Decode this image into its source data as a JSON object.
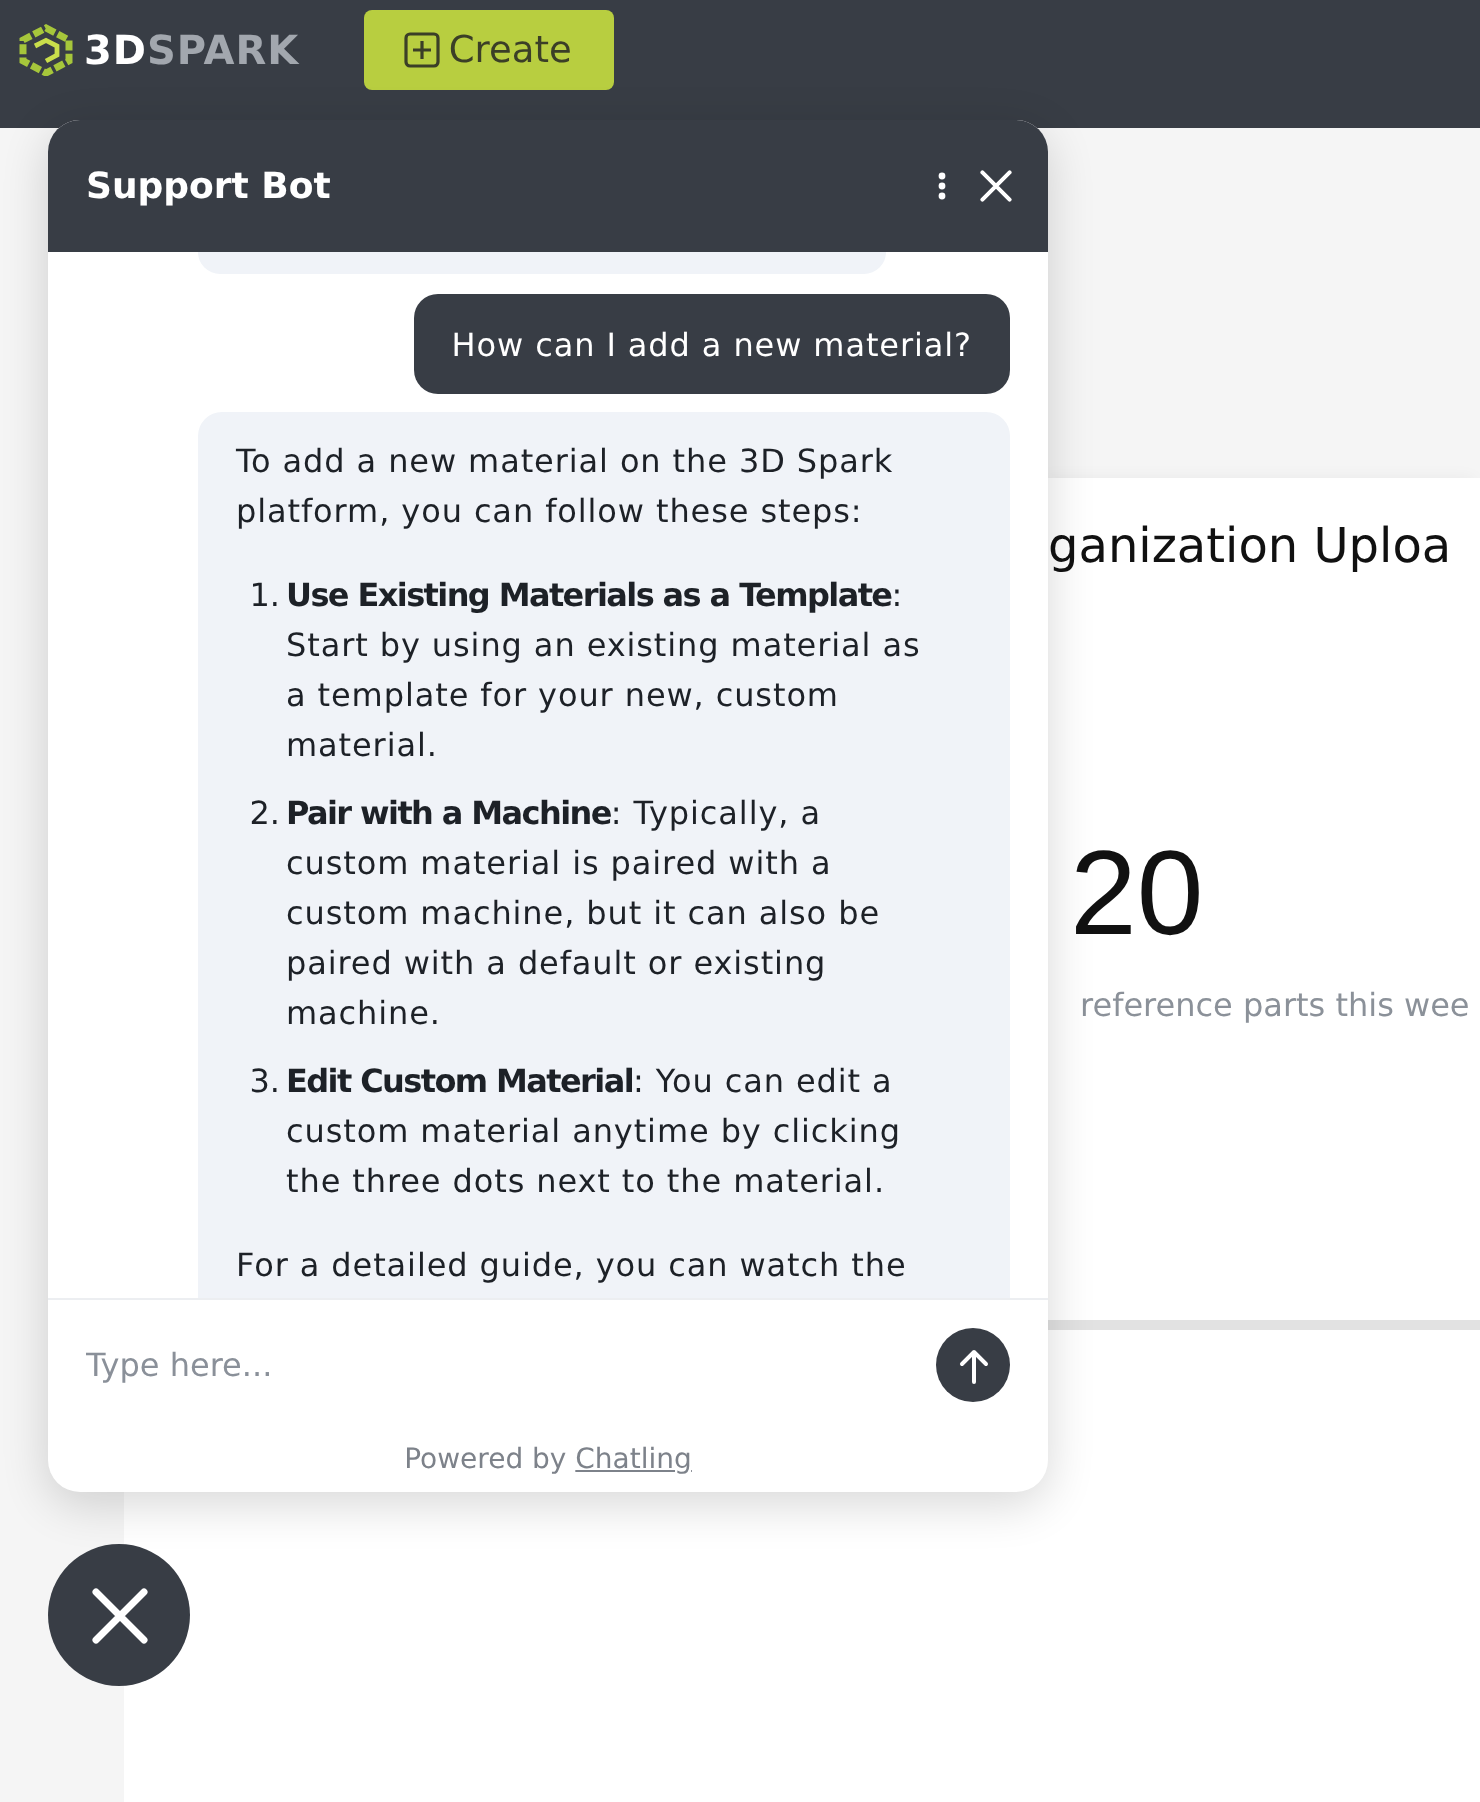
{
  "header": {
    "logo": {
      "lead": "3D",
      "rest": "SPARK"
    },
    "create_button": {
      "label": "Create"
    }
  },
  "dashboard_card": {
    "title": "ganization Uploa",
    "value": "20",
    "caption": "reference parts this wee"
  },
  "chat": {
    "title": "Support Bot",
    "messages": [
      {
        "kind": "bot_clipped"
      },
      {
        "kind": "user",
        "text": "How can I add a new material?"
      },
      {
        "kind": "bot",
        "intro": "To add a new material on the 3D Spark platform, you can follow these steps:",
        "steps": [
          {
            "number": "1.",
            "text": "**Use Existing Materials as a Template**: Start by using an existing material as a template for your new, custom material."
          },
          {
            "number": "2.",
            "text": "**Pair with a Machine**: Typically, a custom material is paired with a custom machine, but it can also be paired with a default or existing machine."
          },
          {
            "number": "3.",
            "text": "**Edit Custom Material**: You can edit a custom material anytime by clicking the three dots next to the material."
          }
        ],
        "outro": "For a detailed guide, you can watch the"
      }
    ],
    "input": {
      "placeholder": "Type here..."
    },
    "footer": {
      "prefix": "Powered by",
      "link": "Chatling"
    }
  }
}
